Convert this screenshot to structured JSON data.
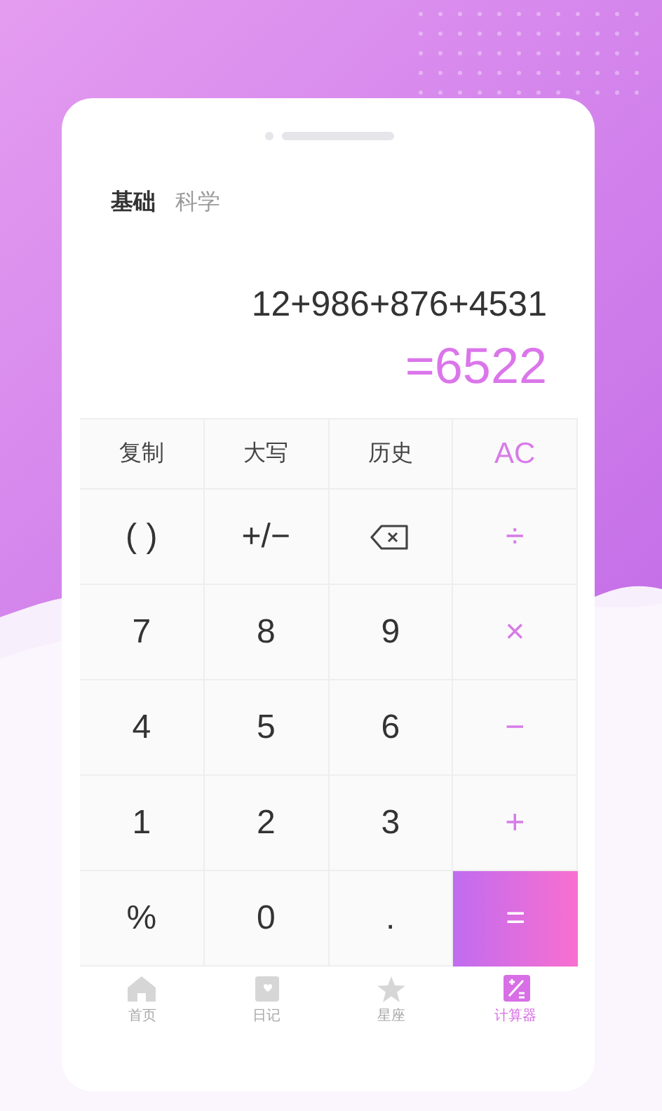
{
  "modes": [
    {
      "label": "基础",
      "selected": true
    },
    {
      "label": "科学",
      "selected": false
    }
  ],
  "display": {
    "expression": "12+986+876+4531",
    "result": "=6522"
  },
  "keys": [
    {
      "kind": "text",
      "label": "复制"
    },
    {
      "kind": "text",
      "label": "大写"
    },
    {
      "kind": "text",
      "label": "历史"
    },
    {
      "kind": "accent",
      "label": "AC"
    },
    {
      "kind": "text",
      "label": "( )"
    },
    {
      "kind": "text",
      "label": "+/−"
    },
    {
      "kind": "backspace"
    },
    {
      "kind": "accent",
      "label": "÷"
    },
    {
      "kind": "text",
      "label": "7"
    },
    {
      "kind": "text",
      "label": "8"
    },
    {
      "kind": "text",
      "label": "9"
    },
    {
      "kind": "accent",
      "label": "×"
    },
    {
      "kind": "text",
      "label": "4"
    },
    {
      "kind": "text",
      "label": "5"
    },
    {
      "kind": "text",
      "label": "6"
    },
    {
      "kind": "accent",
      "label": "−"
    },
    {
      "kind": "text",
      "label": "1"
    },
    {
      "kind": "text",
      "label": "2"
    },
    {
      "kind": "text",
      "label": "3"
    },
    {
      "kind": "accent",
      "label": "+"
    },
    {
      "kind": "text",
      "label": "%"
    },
    {
      "kind": "text",
      "label": "0"
    },
    {
      "kind": "text",
      "label": "."
    },
    {
      "kind": "equals",
      "label": "="
    }
  ],
  "nav": [
    {
      "label": "首页",
      "selected": false
    },
    {
      "label": "日记",
      "selected": false
    },
    {
      "label": "星座",
      "selected": false
    },
    {
      "label": "计算器",
      "selected": true
    }
  ]
}
